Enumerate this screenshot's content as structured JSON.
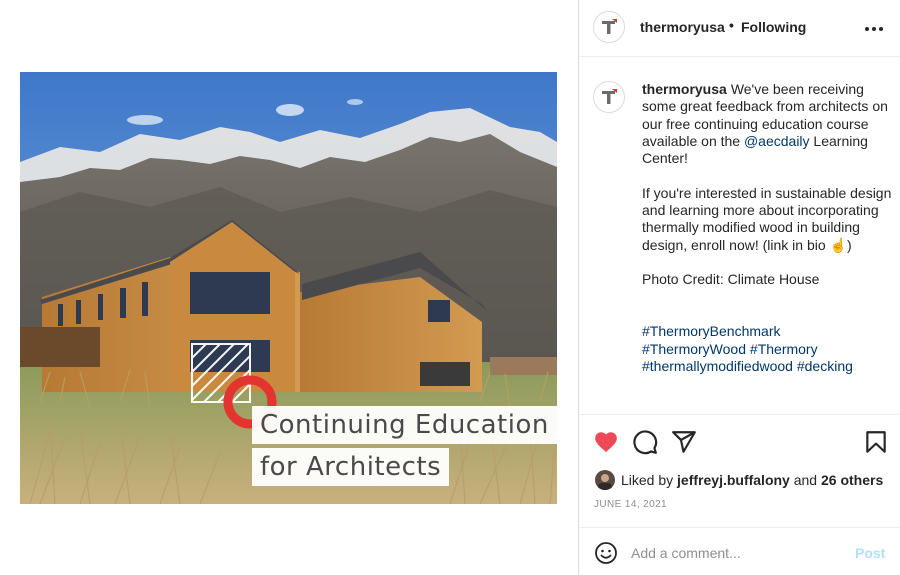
{
  "post": {
    "username": "thermoryusa",
    "follow_status": "Following",
    "media": {
      "overlay_line1": "Continuing Education",
      "overlay_line2": "for Architects"
    },
    "caption": {
      "p1_text": "We've been receiving some great feedback from architects on our free continuing education course available on the ",
      "p1_mention": "@aecdaily",
      "p1_tail": " Learning Center!",
      "p2": "If you're interested in sustainable design and learning more about incorporating thermally modified wood in building design, enroll now! (link in bio ☝️)",
      "p3": "Photo Credit: Climate House",
      "hashtags": [
        "#ThermoryBenchmark",
        "#ThermoryWood",
        "#Thermory",
        "#thermallymodifiedwood",
        "#decking"
      ]
    },
    "likes": {
      "prefix": "Liked by",
      "user": "jeffreyj.buffalony",
      "and": "and",
      "others": "26 others"
    },
    "date": "JUNE 14, 2021",
    "comment": {
      "placeholder": "Add a comment...",
      "post_label": "Post"
    },
    "icons": {
      "more": "more-options-icon",
      "like": "heart-icon",
      "comment": "comment-icon",
      "share": "share-icon",
      "save": "bookmark-icon",
      "emoji": "emoji-icon"
    },
    "colors": {
      "heart": "#ed4956",
      "link": "#00376b",
      "post_disabled": "#b2dffc"
    }
  }
}
